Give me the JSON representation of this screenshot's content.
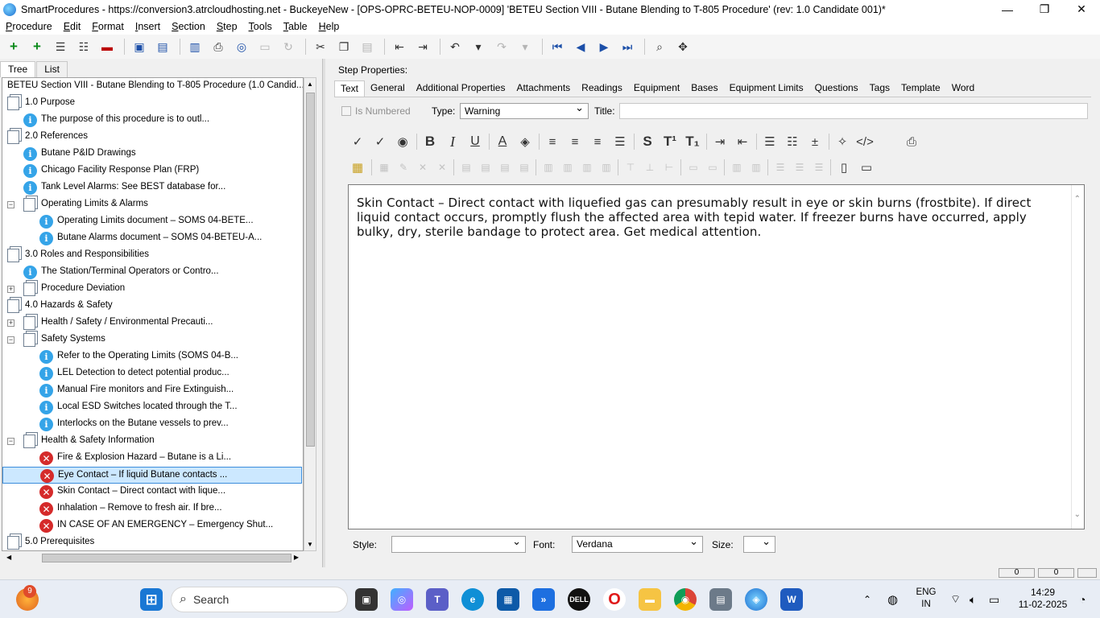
{
  "window": {
    "title": "SmartProcedures - https://conversion3.atrcloudhosting.net - BuckeyeNew - [OPS-OPRC-BETEU-NOP-0009] 'BETEU Section VIII - Butane Blending to T-805 Procedure' (rev: 1.0 Candidate 001)*",
    "min_glyph": "—",
    "max_glyph": "❐",
    "close_glyph": "✕"
  },
  "menu": [
    "Procedure",
    "Edit",
    "Format",
    "Insert",
    "Section",
    "Step",
    "Tools",
    "Table",
    "Help"
  ],
  "left_tabs": [
    "Tree",
    "List"
  ],
  "tree": [
    {
      "label": "BETEU Section VIII - Butane Blending to T-805 Procedure (1.0 Candid...",
      "level": 0,
      "icon": "none",
      "exp": ""
    },
    {
      "label": "1.0 Purpose",
      "level": 0,
      "icon": "section",
      "exp": ""
    },
    {
      "label": "The purpose of this procedure is to outl...",
      "level": 1,
      "icon": "info",
      "exp": ""
    },
    {
      "label": "2.0 References",
      "level": 0,
      "icon": "section",
      "exp": ""
    },
    {
      "label": "Butane P&ID Drawings",
      "level": 1,
      "icon": "info",
      "exp": ""
    },
    {
      "label": "Chicago Facility Response Plan (FRP)",
      "level": 1,
      "icon": "info",
      "exp": ""
    },
    {
      "label": "Tank Level Alarms: See BEST database for...",
      "level": 1,
      "icon": "info",
      "exp": ""
    },
    {
      "label": "Operating Limits & Alarms",
      "level": 1,
      "icon": "section",
      "exp": "−"
    },
    {
      "label": "Operating Limits document – SOMS 04-BETE...",
      "level": 2,
      "icon": "info",
      "exp": ""
    },
    {
      "label": "Butane Alarms document – SOMS 04-BETEU-A...",
      "level": 2,
      "icon": "info",
      "exp": ""
    },
    {
      "label": "3.0 Roles and Responsibilities",
      "level": 0,
      "icon": "section",
      "exp": ""
    },
    {
      "label": "The Station/Terminal Operators or Contro...",
      "level": 1,
      "icon": "info",
      "exp": ""
    },
    {
      "label": "Procedure Deviation",
      "level": 1,
      "icon": "section",
      "exp": "+"
    },
    {
      "label": "4.0 Hazards & Safety",
      "level": 0,
      "icon": "section",
      "exp": ""
    },
    {
      "label": "Health / Safety / Environmental Precauti...",
      "level": 1,
      "icon": "section",
      "exp": "+"
    },
    {
      "label": "Safety Systems",
      "level": 1,
      "icon": "section",
      "exp": "−"
    },
    {
      "label": "Refer to the Operating Limits (SOMS 04-B...",
      "level": 2,
      "icon": "info",
      "exp": ""
    },
    {
      "label": "LEL Detection to detect potential produc...",
      "level": 2,
      "icon": "info",
      "exp": ""
    },
    {
      "label": "Manual Fire monitors and Fire Extinguish...",
      "level": 2,
      "icon": "info",
      "exp": ""
    },
    {
      "label": "Local ESD Switches located through the T...",
      "level": 2,
      "icon": "info",
      "exp": ""
    },
    {
      "label": "Interlocks on the Butane vessels to prev...",
      "level": 2,
      "icon": "info",
      "exp": ""
    },
    {
      "label": "Health & Safety Information",
      "level": 1,
      "icon": "section",
      "exp": "−"
    },
    {
      "label": "Fire & Explosion Hazard – Butane is a Li...",
      "level": 2,
      "icon": "error",
      "exp": ""
    },
    {
      "label": "Eye Contact – If liquid Butane contacts ...",
      "level": 2,
      "icon": "error",
      "exp": "",
      "selected": true
    },
    {
      "label": "Skin Contact – Direct contact with lique...",
      "level": 2,
      "icon": "error",
      "exp": ""
    },
    {
      "label": "Inhalation – Remove to fresh air. If bre...",
      "level": 2,
      "icon": "error",
      "exp": ""
    },
    {
      "label": "IN CASE OF AN EMERGENCY – Emergency Shut...",
      "level": 2,
      "icon": "error",
      "exp": ""
    },
    {
      "label": "5.0 Prerequisites",
      "level": 0,
      "icon": "section",
      "exp": ""
    }
  ],
  "step_properties": {
    "label": "Step Properties:",
    "tabs": [
      "Text",
      "General",
      "Additional Properties",
      "Attachments",
      "Readings",
      "Equipment",
      "Bases",
      "Equipment Limits",
      "Questions",
      "Tags",
      "Template",
      "Word"
    ],
    "is_numbered_label": "Is Numbered",
    "type_label": "Type:",
    "type_value": "Warning",
    "title_label": "Title:",
    "title_value": "",
    "editor_text": "Skin Contact – Direct contact with liquefied gas can presumably result in eye or skin burns (frostbite). If direct liquid contact occurs, promptly flush the affected area with tepid water. If freezer burns have occurred, apply bulky, dry, sterile bandage to protect area. Get medical attention.",
    "style_label": "Style:",
    "style_value": "",
    "font_label": "Font:",
    "font_value": "Verdana",
    "size_label": "Size:",
    "size_value": ""
  },
  "format_bar": {
    "spell": "✓",
    "spell2": "✓",
    "bold": "B",
    "italic": "I",
    "underline": "U",
    "fontcolor": "A",
    "strike": "S",
    "superscript": "T¹",
    "subscript": "T₁",
    "html": "</>"
  },
  "status_boxes": [
    "0",
    "0"
  ],
  "taskbar": {
    "search_placeholder": "Search",
    "lang_line1": "ENG",
    "lang_line2": "IN",
    "time": "14:29",
    "date": "11-02-2025",
    "notification_count": "9"
  },
  "colors": {
    "accent": "#3c8ddb",
    "selection": "#cce8ff",
    "info_icon": "#35a4e8",
    "error_icon": "#d52b2b"
  }
}
